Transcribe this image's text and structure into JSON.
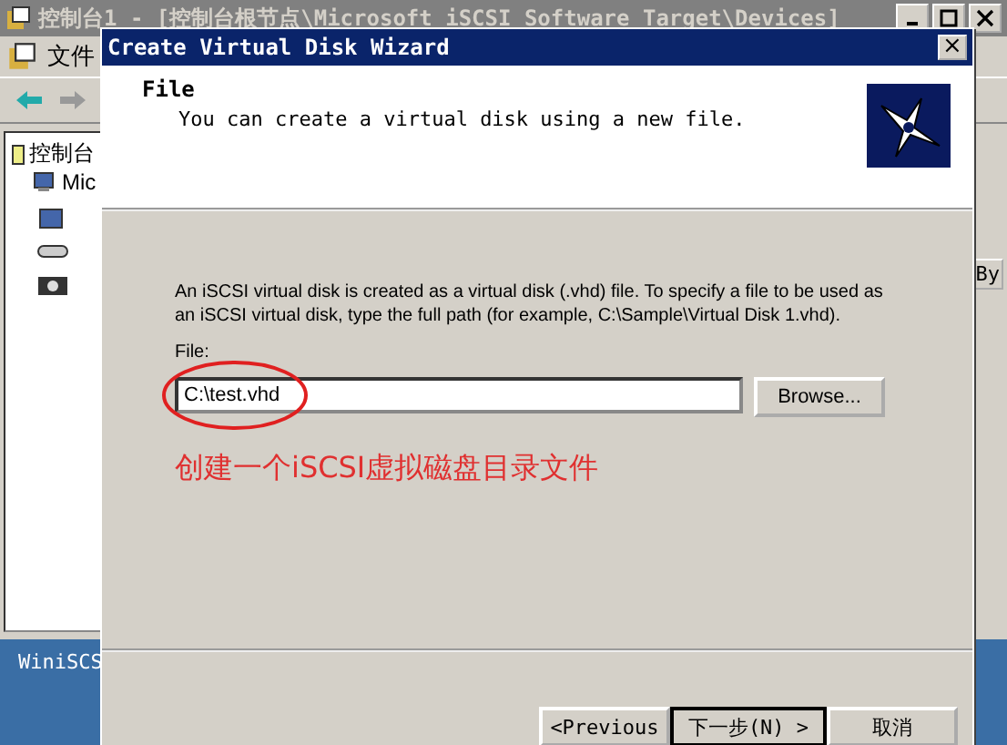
{
  "background_window": {
    "title": "控制台1 - [控制台根节点\\Microsoft iSCSI Software Target\\Devices]",
    "menu": [
      "文件"
    ],
    "tree": [
      {
        "label": "控制台",
        "children": [
          {
            "label": "Mic"
          }
        ]
      }
    ],
    "right_column_label": "By"
  },
  "taskbar": {
    "item": "WiniSCS"
  },
  "dialog": {
    "title": "Create Virtual Disk Wizard",
    "close": "×",
    "header": {
      "title": "File",
      "subtitle": "You can create a virtual disk using a new file."
    },
    "description": "An iSCSI virtual disk is created as a virtual disk (.vhd) file. To specify a file to be used as an iSCSI virtual disk, type the full path (for example, C:\\Sample\\Virtual Disk 1.vhd).",
    "file_label": "File:",
    "file_value": "C:\\test.vhd",
    "browse": "Browse...",
    "annotation": "创建一个iSCSI虚拟磁盘目录文件",
    "buttons": [
      {
        "label": "<Previous",
        "default": false
      },
      {
        "label": "下一步(N) >",
        "default": true
      },
      {
        "label": "取消",
        "default": false
      }
    ]
  }
}
